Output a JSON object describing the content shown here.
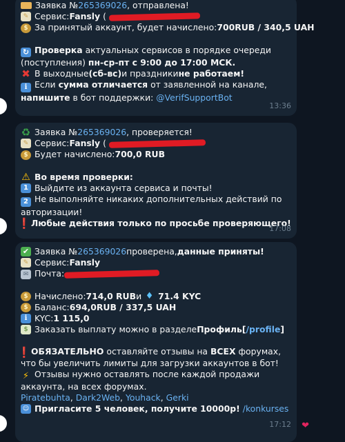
{
  "messages": [
    {
      "time": "13:36",
      "l1": {
        "a": "Заявка №",
        "id": "265369026",
        "b": ", отправлена!"
      },
      "l2": {
        "a": "Сервис: ",
        "service": "Fansly",
        "paren": "("
      },
      "l3": {
        "a": "За принятый аккаунт, будет начислено: ",
        "amount": "700RUB  / 340,5 UAH"
      },
      "l4": {
        "b1": "Проверка",
        "a": " актуальных сервисов в порядке очереди (поступления) ",
        "b2": "пн-ср-пт с 9:00 до 17:00 МСК."
      },
      "l5": {
        "a": "В выходные ",
        "b1": "(сб-вс)",
        "c": " и праздники ",
        "b2": "не работаем!"
      },
      "l6": {
        "a": "Если ",
        "b1": "сумма отличается",
        "c": " от заявленной на канале,  ",
        "b2": "напишите",
        "d": " в бот поддержки: ",
        "link": "@VerifSupportBot"
      }
    },
    {
      "time": "17:08",
      "l1": {
        "a": "Заявка №",
        "id": "265369026",
        "b": ", проверяется!"
      },
      "l2": {
        "a": "Сервис: ",
        "service": "Fansly",
        "paren": "("
      },
      "l3": {
        "a": "Будет начислено: ",
        "amount": "700,0 RUB"
      },
      "l4": {
        "b": "Во время проверки:"
      },
      "l5": {
        "a": "Выйдите из аккаунта сервиса и почты!"
      },
      "l6": {
        "a": "Не выполняйте никаких дополнительных действий по авторизации!"
      },
      "l7": {
        "b": "Любые действия только по просьбе проверяющего!"
      }
    },
    {
      "time": "17:12",
      "l1": {
        "a": "Заявка №",
        "id": "265369026",
        "b": " проверена, ",
        "bold": "данные приняты!"
      },
      "l2": {
        "a": "Сервис: ",
        "service": "Fansly"
      },
      "l3": {
        "a": "Почта: "
      },
      "l4": {
        "a": "Начислено: ",
        "rub": "714,0 RUB",
        "mid": " и ",
        "kyc": "71.4 KYC"
      },
      "l5": {
        "a": "Баланс: ",
        "v": "694,0RUB  / 337,5 UAH"
      },
      "l6": {
        "a": "KYC: ",
        "v": "1 115,0"
      },
      "l7": {
        "a": "Заказать выплату можно в разделе ",
        "b": "Профиль",
        "c": " [",
        "link": "/profile",
        "d": "]"
      },
      "l8": {
        "b1": "ОБЯЗАТЕЛЬНО",
        "a": " оставляйте отзывы на ",
        "b2": "ВСЕХ",
        "c": " форумах, что бы увеличить лимиты для загрузки аккаунтов в бот!"
      },
      "l9": {
        "a": "Отзывы нужно оставлять после каждой продажи аккаунта, на всех форумах."
      },
      "forums": [
        "Piratebuhta",
        "Dark2Web",
        "Youhack",
        "Gerki"
      ],
      "l10": {
        "b": "Пригласите 5 человек, получите 10000р!",
        "link": "/konkurses"
      }
    }
  ],
  "icons": [
    "tag-icon",
    "memo-icon",
    "money-bag-icon",
    "cycle-icon",
    "cross-mark-icon",
    "info-icon",
    "recycle-icon",
    "warning-icon",
    "keycap-1-icon",
    "keycap-2-icon",
    "exclamation-icon",
    "check-mark-icon",
    "mail-icon",
    "diamond-icon",
    "banknote-icon",
    "zap-icon",
    "people-icon",
    "heart-icon"
  ],
  "colors": {
    "background": "#0e1621",
    "bubble": "#182533",
    "link": "#6ab2f2",
    "time": "#6d7f8f",
    "redaction": "#e01b24"
  }
}
